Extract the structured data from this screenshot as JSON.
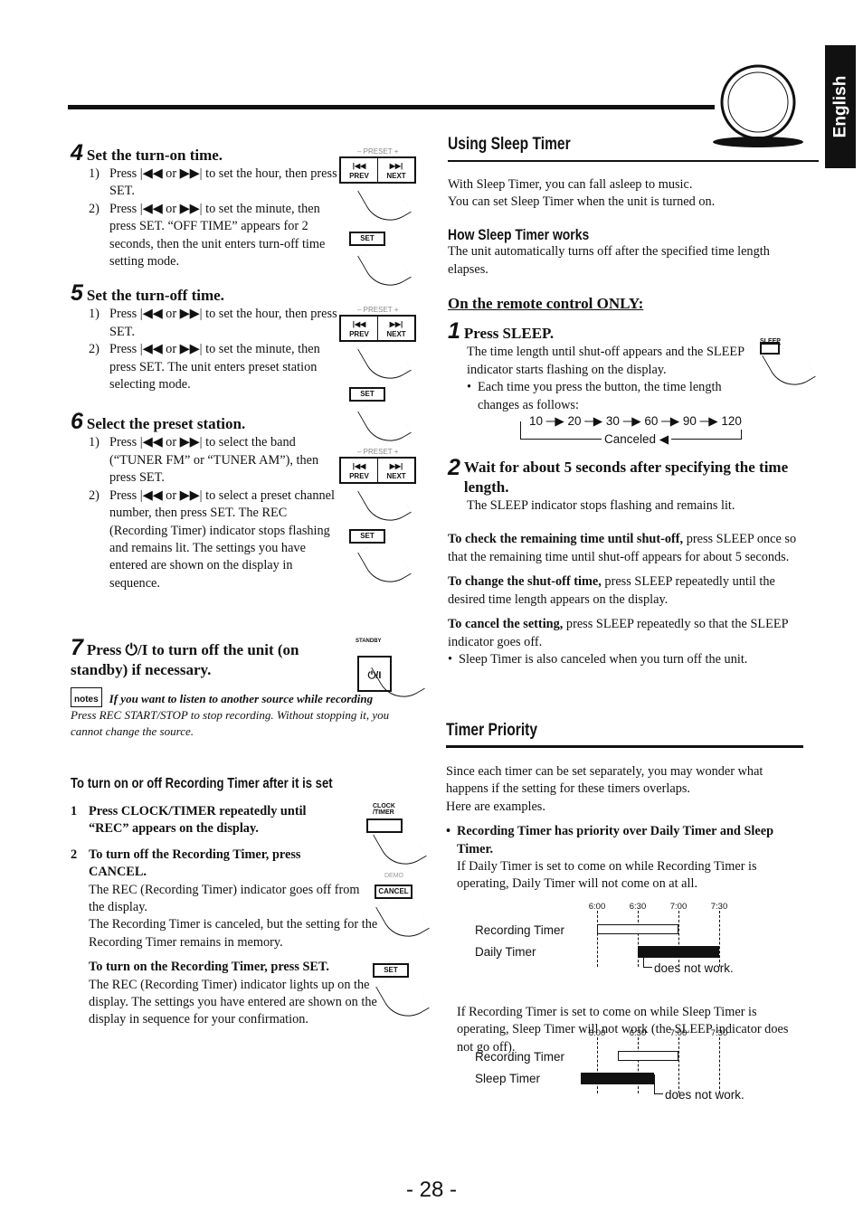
{
  "tab": "English",
  "left": {
    "steps": [
      {
        "num": "4",
        "title": "Set the turn-on time.",
        "subs": [
          {
            "n": "1)",
            "t": "Press |◀◀ or ▶▶| to set the hour, then press SET."
          },
          {
            "n": "2)",
            "t": "Press |◀◀ or ▶▶| to set the minute, then press SET. “OFF TIME” appears for 2 seconds, then the unit enters turn-off time setting mode."
          }
        ]
      },
      {
        "num": "5",
        "title": "Set the turn-off time.",
        "subs": [
          {
            "n": "1)",
            "t": "Press |◀◀ or ▶▶| to set the hour, then press SET."
          },
          {
            "n": "2)",
            "t": "Press |◀◀ or ▶▶| to set the minute, then press SET. The unit enters preset station selecting mode."
          }
        ]
      },
      {
        "num": "6",
        "title": "Select the preset station.",
        "subs": [
          {
            "n": "1)",
            "t": "Press |◀◀ or ▶▶| to select the band (“TUNER FM” or “TUNER AM”), then press SET."
          },
          {
            "n": "2)",
            "t": "Press |◀◀ or ▶▶| to select a preset channel number, then press SET. The REC (Recording Timer) indicator stops flashing and remains lit. The settings you have entered are shown on the display in sequence."
          }
        ]
      }
    ],
    "step7": {
      "num": "7",
      "title": "Press ⏻/I to turn off the unit (on standby) if necessary."
    },
    "btn": {
      "prev": "|◀◀ PREV",
      "next": "▶▶| NEXT",
      "set": "SET",
      "preset": "– PRESET +",
      "standby": "STANDBY",
      "power": "⏻/I",
      "clock": "CLOCK /TIMER",
      "cancel": "CANCEL",
      "demo": "DEMO"
    },
    "notes": {
      "logo": "notes",
      "title": "If you want to listen to another source while recording",
      "text": "Press REC START/STOP to stop recording. Without stopping it, you cannot change the source."
    },
    "rec_section": {
      "heading": "To turn on or off Recording Timer after it is set",
      "item1": {
        "n": "1",
        "t": "Press CLOCK/TIMER repeatedly until “REC” appears on the display."
      },
      "item2": {
        "n": "2",
        "t": "To turn off the Recording Timer, press CANCEL.",
        "body1": "The REC (Recording Timer) indicator goes off from the display.",
        "body2": "The Recording Timer is canceled, but the setting for the Recording Timer remains in memory."
      },
      "turn_on": {
        "bold": "To turn on the Recording Timer, press SET.",
        "body": "The REC (Recording Timer) indicator lights up on the display. The settings you have entered are shown on the display in sequence for your confirmation."
      }
    }
  },
  "right": {
    "heading": "Using Sleep Timer",
    "intro1": "With Sleep Timer, you can fall asleep to music.",
    "intro2": "You can set Sleep Timer when the unit is turned on.",
    "how_h": "How Sleep Timer works",
    "how_t": "The unit automatically turns off after the specified time length elapses.",
    "remote_h": "On the remote control ONLY:",
    "s1": {
      "num": "1",
      "title": "Press SLEEP.",
      "t": "The time length until shut-off appears and the SLEEP indicator starts flashing on the display.",
      "bullet": "Each time you press the button, the time length changes as follows:",
      "btn": "SLEEP"
    },
    "cycle": {
      "seq": "10 ─▶ 20 ─▶ 30 ─▶ 60 ─▶ 90 ─▶ 120",
      "canceled": "Canceled ◀"
    },
    "s2": {
      "num": "2",
      "title": "Wait for about 5 seconds after specifying the time length.",
      "t": "The SLEEP indicator stops flashing and remains lit."
    },
    "check": {
      "b": "To check the remaining time until shut-off,",
      "t": " press SLEEP once so that the remaining time until shut-off appears for about 5 seconds."
    },
    "change": {
      "b": "To change the shut-off time,",
      "t": " press SLEEP repeatedly until the desired time length appears on the display."
    },
    "cancel": {
      "b": "To cancel the setting,",
      "t": " press SLEEP repeatedly so that the SLEEP indicator goes off.",
      "bullet": "Sleep Timer is also canceled when you turn off the unit."
    },
    "prio_h": "Timer Priority",
    "prio1": "Since each timer can be set separately, you may wonder what happens if the setting for these timers overlaps.",
    "prio2": "Here are examples.",
    "prio_b": "Recording Timer has priority over Daily Timer and Sleep Timer.",
    "prio_b_t": "If Daily Timer is set to come on while Recording Timer is operating, Daily Timer will not come on at all.",
    "prio_c": "If Recording Timer is set to come on while Sleep Timer is operating, Sleep Timer will not work (the SLEEP indicator does not go off)."
  },
  "chart_data": [
    {
      "type": "timeline",
      "ticks": [
        "6:00",
        "6:30",
        "7:00",
        "7:30"
      ],
      "rows": [
        {
          "name": "Recording Timer",
          "start": "6:00",
          "end": "7:00",
          "fill": "white"
        },
        {
          "name": "Daily Timer",
          "start": "6:30",
          "end": "7:30",
          "fill": "black"
        }
      ],
      "annotation": "does not work."
    },
    {
      "type": "timeline",
      "ticks": [
        "6:00",
        "6:30",
        "7:00",
        "7:30"
      ],
      "rows": [
        {
          "name": "Recording Timer",
          "start": "6:15",
          "end": "7:00",
          "fill": "white"
        },
        {
          "name": "Sleep Timer",
          "start": "5:48",
          "end": "6:42",
          "fill": "black"
        }
      ],
      "annotation": "does not work."
    }
  ],
  "page_number": "- 28 -"
}
